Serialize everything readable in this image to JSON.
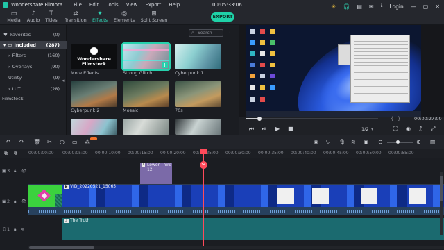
{
  "titlebar": {
    "app_title": "Wondershare Filmora",
    "menu": [
      "File",
      "Edit",
      "Tools",
      "View",
      "Export",
      "Help"
    ],
    "timecode": "00:05:33:06",
    "login": "Login"
  },
  "tabs": [
    {
      "label": "Media",
      "icon": "folder-icon"
    },
    {
      "label": "Audio",
      "icon": "music-icon"
    },
    {
      "label": "Titles",
      "icon": "text-icon"
    },
    {
      "label": "Transition",
      "icon": "transition-icon"
    },
    {
      "label": "Effects",
      "icon": "effects-icon",
      "active": true
    },
    {
      "label": "Elements",
      "icon": "elements-icon"
    },
    {
      "label": "Split Screen",
      "icon": "split-screen-icon"
    }
  ],
  "export_label": "EXPORT",
  "sidebar": {
    "items": [
      {
        "label": "Favorites",
        "count": "(0)"
      },
      {
        "label": "Included",
        "count": "(287)",
        "selected": true
      },
      {
        "label": "Filters",
        "count": "(160)"
      },
      {
        "label": "Overlays",
        "count": "(90)"
      },
      {
        "label": "Utility",
        "count": "(9)"
      },
      {
        "label": "LUT",
        "count": "(28)"
      },
      {
        "label": "Filmstock",
        "count": ""
      }
    ]
  },
  "effects": {
    "search_placeholder": "Search",
    "filmstock_brand": "Wondershare\nFilmstock",
    "items": [
      {
        "label": "More Effects"
      },
      {
        "label": "Strong Glitch",
        "selected": true
      },
      {
        "label": "Cyberpunk 1"
      },
      {
        "label": "Cyberpunk 2"
      },
      {
        "label": "Mosaic"
      },
      {
        "label": "70s"
      },
      {
        "label": ""
      },
      {
        "label": ""
      },
      {
        "label": ""
      }
    ]
  },
  "preview": {
    "current_time": "00:00:27:00",
    "zoom": "1/2",
    "colors": {
      "accent": "#1fd2a8",
      "playhead": "#ff4a5a"
    }
  },
  "timeline": {
    "ruler_ticks": [
      "00:00:00:00",
      "00:00:05:00",
      "00:00:10:00",
      "00:00:15:00",
      "00:00:20:00",
      "00:00:25:00",
      "00:00:30:00",
      "00:00:35:00",
      "00:00:40:00",
      "00:00:45:00",
      "00:00:50:00",
      "00:00:55:00"
    ],
    "title_clip": "Lower Third 12",
    "video_clip": "VID_20220521_15065",
    "audio_clip": "The Truth",
    "track_numbers": [
      "3",
      "2",
      "1"
    ]
  }
}
